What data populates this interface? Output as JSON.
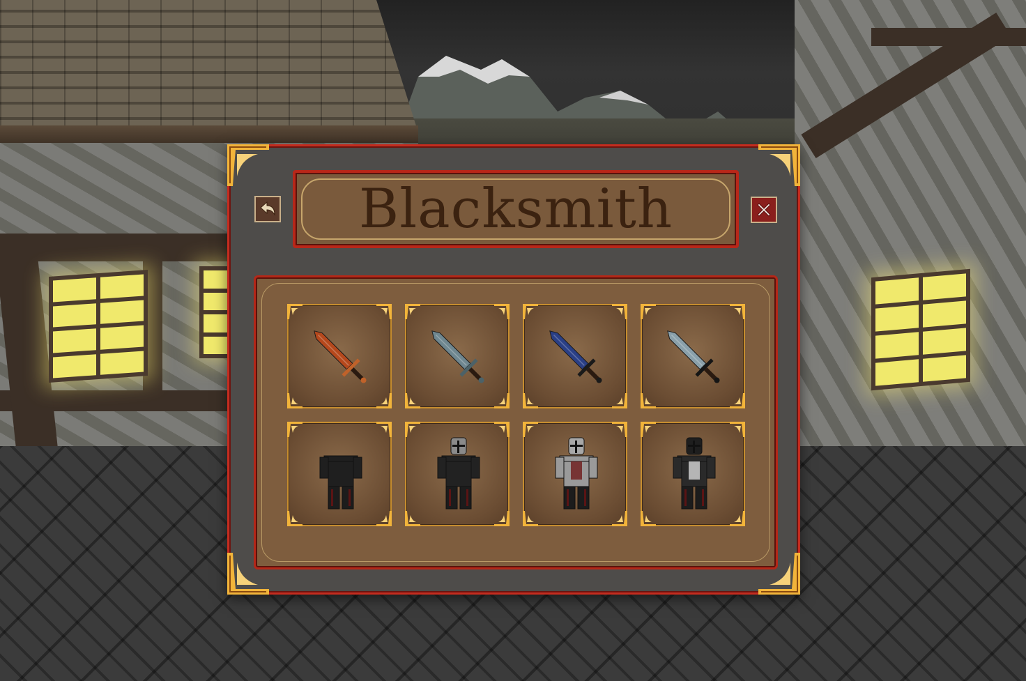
{
  "window": {
    "title": "Blacksmith"
  },
  "buttons": {
    "back_icon": "back-arrow-icon",
    "close_icon": "close-x-icon"
  },
  "colors": {
    "frame_red": "#c42c1f",
    "gold": "#f2b43a",
    "panel_brown": "#7e5d3e",
    "title_text": "#3b2210"
  },
  "items": [
    {
      "id": "weapon-1",
      "type": "sword",
      "color": "#b5481c",
      "guard": "#c0622a"
    },
    {
      "id": "weapon-2",
      "type": "sword",
      "color": "#6f8790",
      "guard": "#4c6268"
    },
    {
      "id": "weapon-3",
      "type": "sword",
      "color": "#2a3f86",
      "guard": "#1a1a1a"
    },
    {
      "id": "weapon-4",
      "type": "sword",
      "color": "#8aa0aa",
      "guard": "#151515"
    },
    {
      "id": "armor-1",
      "type": "armor",
      "color": "#1f1f1f",
      "helmet": false
    },
    {
      "id": "armor-2",
      "type": "armor",
      "color": "#222222",
      "helmet": true,
      "helmet_color": "#8a8a8a"
    },
    {
      "id": "armor-3",
      "type": "armor",
      "color": "#9a9a9a",
      "helmet": true,
      "helmet_color": "#a8a8a8",
      "accent": "#6e1a1a"
    },
    {
      "id": "armor-4",
      "type": "armor",
      "color": "#2a2a2a",
      "helmet": true,
      "helmet_color": "#1e1e1e",
      "accent": "#d8d8d8"
    }
  ]
}
